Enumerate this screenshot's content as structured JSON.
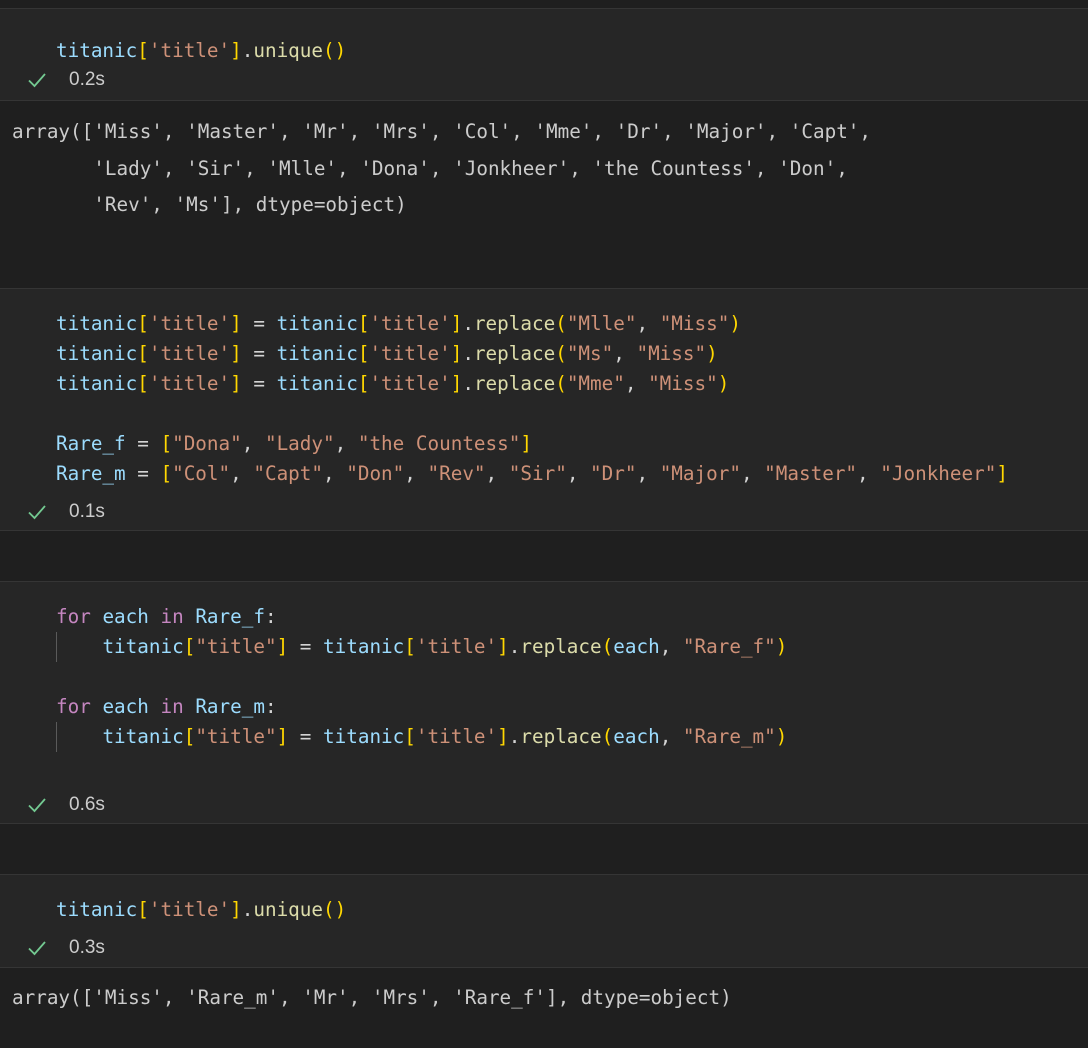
{
  "cells": [
    {
      "code_lines": [
        [
          [
            "var",
            "titanic"
          ],
          [
            "br1",
            "["
          ],
          [
            "str",
            "'title'"
          ],
          [
            "br1",
            "]"
          ],
          [
            "op",
            "."
          ],
          [
            "fn",
            "unique"
          ],
          [
            "br1",
            "()"
          ]
        ]
      ],
      "time": "0.2s",
      "output_lines": [
        "array(['Miss', 'Master', 'Mr', 'Mrs', 'Col', 'Mme', 'Dr', 'Major', 'Capt',",
        "       'Lady', 'Sir', 'Mlle', 'Dona', 'Jonkheer', 'the Countess', 'Don',",
        "       'Rev', 'Ms'], dtype=object)"
      ]
    },
    {
      "code_lines": [
        [
          [
            "var",
            "titanic"
          ],
          [
            "br1",
            "["
          ],
          [
            "str",
            "'title'"
          ],
          [
            "br1",
            "]"
          ],
          [
            "op",
            " = "
          ],
          [
            "var",
            "titanic"
          ],
          [
            "br1",
            "["
          ],
          [
            "str",
            "'title'"
          ],
          [
            "br1",
            "]"
          ],
          [
            "op",
            "."
          ],
          [
            "fn",
            "replace"
          ],
          [
            "br1",
            "("
          ],
          [
            "str",
            "\"Mlle\""
          ],
          [
            "op",
            ", "
          ],
          [
            "str",
            "\"Miss\""
          ],
          [
            "br1",
            ")"
          ]
        ],
        [
          [
            "var",
            "titanic"
          ],
          [
            "br1",
            "["
          ],
          [
            "str",
            "'title'"
          ],
          [
            "br1",
            "]"
          ],
          [
            "op",
            " = "
          ],
          [
            "var",
            "titanic"
          ],
          [
            "br1",
            "["
          ],
          [
            "str",
            "'title'"
          ],
          [
            "br1",
            "]"
          ],
          [
            "op",
            "."
          ],
          [
            "fn",
            "replace"
          ],
          [
            "br1",
            "("
          ],
          [
            "str",
            "\"Ms\""
          ],
          [
            "op",
            ", "
          ],
          [
            "str",
            "\"Miss\""
          ],
          [
            "br1",
            ")"
          ]
        ],
        [
          [
            "var",
            "titanic"
          ],
          [
            "br1",
            "["
          ],
          [
            "str",
            "'title'"
          ],
          [
            "br1",
            "]"
          ],
          [
            "op",
            " = "
          ],
          [
            "var",
            "titanic"
          ],
          [
            "br1",
            "["
          ],
          [
            "str",
            "'title'"
          ],
          [
            "br1",
            "]"
          ],
          [
            "op",
            "."
          ],
          [
            "fn",
            "replace"
          ],
          [
            "br1",
            "("
          ],
          [
            "str",
            "\"Mme\""
          ],
          [
            "op",
            ", "
          ],
          [
            "str",
            "\"Miss\""
          ],
          [
            "br1",
            ")"
          ]
        ],
        [],
        [
          [
            "var",
            "Rare_f"
          ],
          [
            "op",
            " = "
          ],
          [
            "br1",
            "["
          ],
          [
            "str",
            "\"Dona\""
          ],
          [
            "op",
            ", "
          ],
          [
            "str",
            "\"Lady\""
          ],
          [
            "op",
            ", "
          ],
          [
            "str",
            "\"the Countess\""
          ],
          [
            "br1",
            "]"
          ]
        ],
        [
          [
            "var",
            "Rare_m"
          ],
          [
            "op",
            " = "
          ],
          [
            "br1",
            "["
          ],
          [
            "str",
            "\"Col\""
          ],
          [
            "op",
            ", "
          ],
          [
            "str",
            "\"Capt\""
          ],
          [
            "op",
            ", "
          ],
          [
            "str",
            "\"Don\""
          ],
          [
            "op",
            ", "
          ],
          [
            "str",
            "\"Rev\""
          ],
          [
            "op",
            ", "
          ],
          [
            "str",
            "\"Sir\""
          ],
          [
            "op",
            ", "
          ],
          [
            "str",
            "\"Dr\""
          ],
          [
            "op",
            ", "
          ],
          [
            "str",
            "\"Major\""
          ],
          [
            "op",
            ", "
          ],
          [
            "str",
            "\"Master\""
          ],
          [
            "op",
            ", "
          ],
          [
            "str",
            "\"Jonkheer\""
          ],
          [
            "br1",
            "]"
          ]
        ]
      ],
      "time": "0.1s",
      "output_lines": []
    },
    {
      "code_lines": [
        [
          [
            "kw",
            "for"
          ],
          [
            "op",
            " "
          ],
          [
            "var",
            "each"
          ],
          [
            "op",
            " "
          ],
          [
            "kw",
            "in"
          ],
          [
            "op",
            " "
          ],
          [
            "var",
            "Rare_f"
          ],
          [
            "op",
            ":"
          ]
        ],
        [
          [
            "guide",
            ""
          ],
          [
            "op",
            "    "
          ],
          [
            "var",
            "titanic"
          ],
          [
            "br1",
            "["
          ],
          [
            "str",
            "\"title\""
          ],
          [
            "br1",
            "]"
          ],
          [
            "op",
            " = "
          ],
          [
            "var",
            "titanic"
          ],
          [
            "br1",
            "["
          ],
          [
            "str",
            "'title'"
          ],
          [
            "br1",
            "]"
          ],
          [
            "op",
            "."
          ],
          [
            "fn",
            "replace"
          ],
          [
            "br1",
            "("
          ],
          [
            "var",
            "each"
          ],
          [
            "op",
            ", "
          ],
          [
            "str",
            "\"Rare_f\""
          ],
          [
            "br1",
            ")"
          ]
        ],
        [],
        [
          [
            "kw",
            "for"
          ],
          [
            "op",
            " "
          ],
          [
            "var",
            "each"
          ],
          [
            "op",
            " "
          ],
          [
            "kw",
            "in"
          ],
          [
            "op",
            " "
          ],
          [
            "var",
            "Rare_m"
          ],
          [
            "op",
            ":"
          ]
        ],
        [
          [
            "guide",
            ""
          ],
          [
            "op",
            "    "
          ],
          [
            "var",
            "titanic"
          ],
          [
            "br1",
            "["
          ],
          [
            "str",
            "\"title\""
          ],
          [
            "br1",
            "]"
          ],
          [
            "op",
            " = "
          ],
          [
            "var",
            "titanic"
          ],
          [
            "br1",
            "["
          ],
          [
            "str",
            "'title'"
          ],
          [
            "br1",
            "]"
          ],
          [
            "op",
            "."
          ],
          [
            "fn",
            "replace"
          ],
          [
            "br1",
            "("
          ],
          [
            "var",
            "each"
          ],
          [
            "op",
            ", "
          ],
          [
            "str",
            "\"Rare_m\""
          ],
          [
            "br1",
            ")"
          ]
        ]
      ],
      "time": "0.6s",
      "output_lines": []
    },
    {
      "code_lines": [
        [
          [
            "var",
            "titanic"
          ],
          [
            "br1",
            "["
          ],
          [
            "str",
            "'title'"
          ],
          [
            "br1",
            "]"
          ],
          [
            "op",
            "."
          ],
          [
            "fn",
            "unique"
          ],
          [
            "br1",
            "()"
          ]
        ]
      ],
      "time": "0.3s",
      "output_lines": [
        "array(['Miss', 'Rare_m', 'Mr', 'Mrs', 'Rare_f'], dtype=object)"
      ]
    }
  ],
  "icons": {
    "status": "check-icon"
  },
  "colors": {
    "check": "#73c991",
    "variable": "#9cdcfe",
    "string": "#ce9178",
    "bracket": "#ffd700",
    "function": "#dcdcaa",
    "keyword": "#c586c0"
  }
}
